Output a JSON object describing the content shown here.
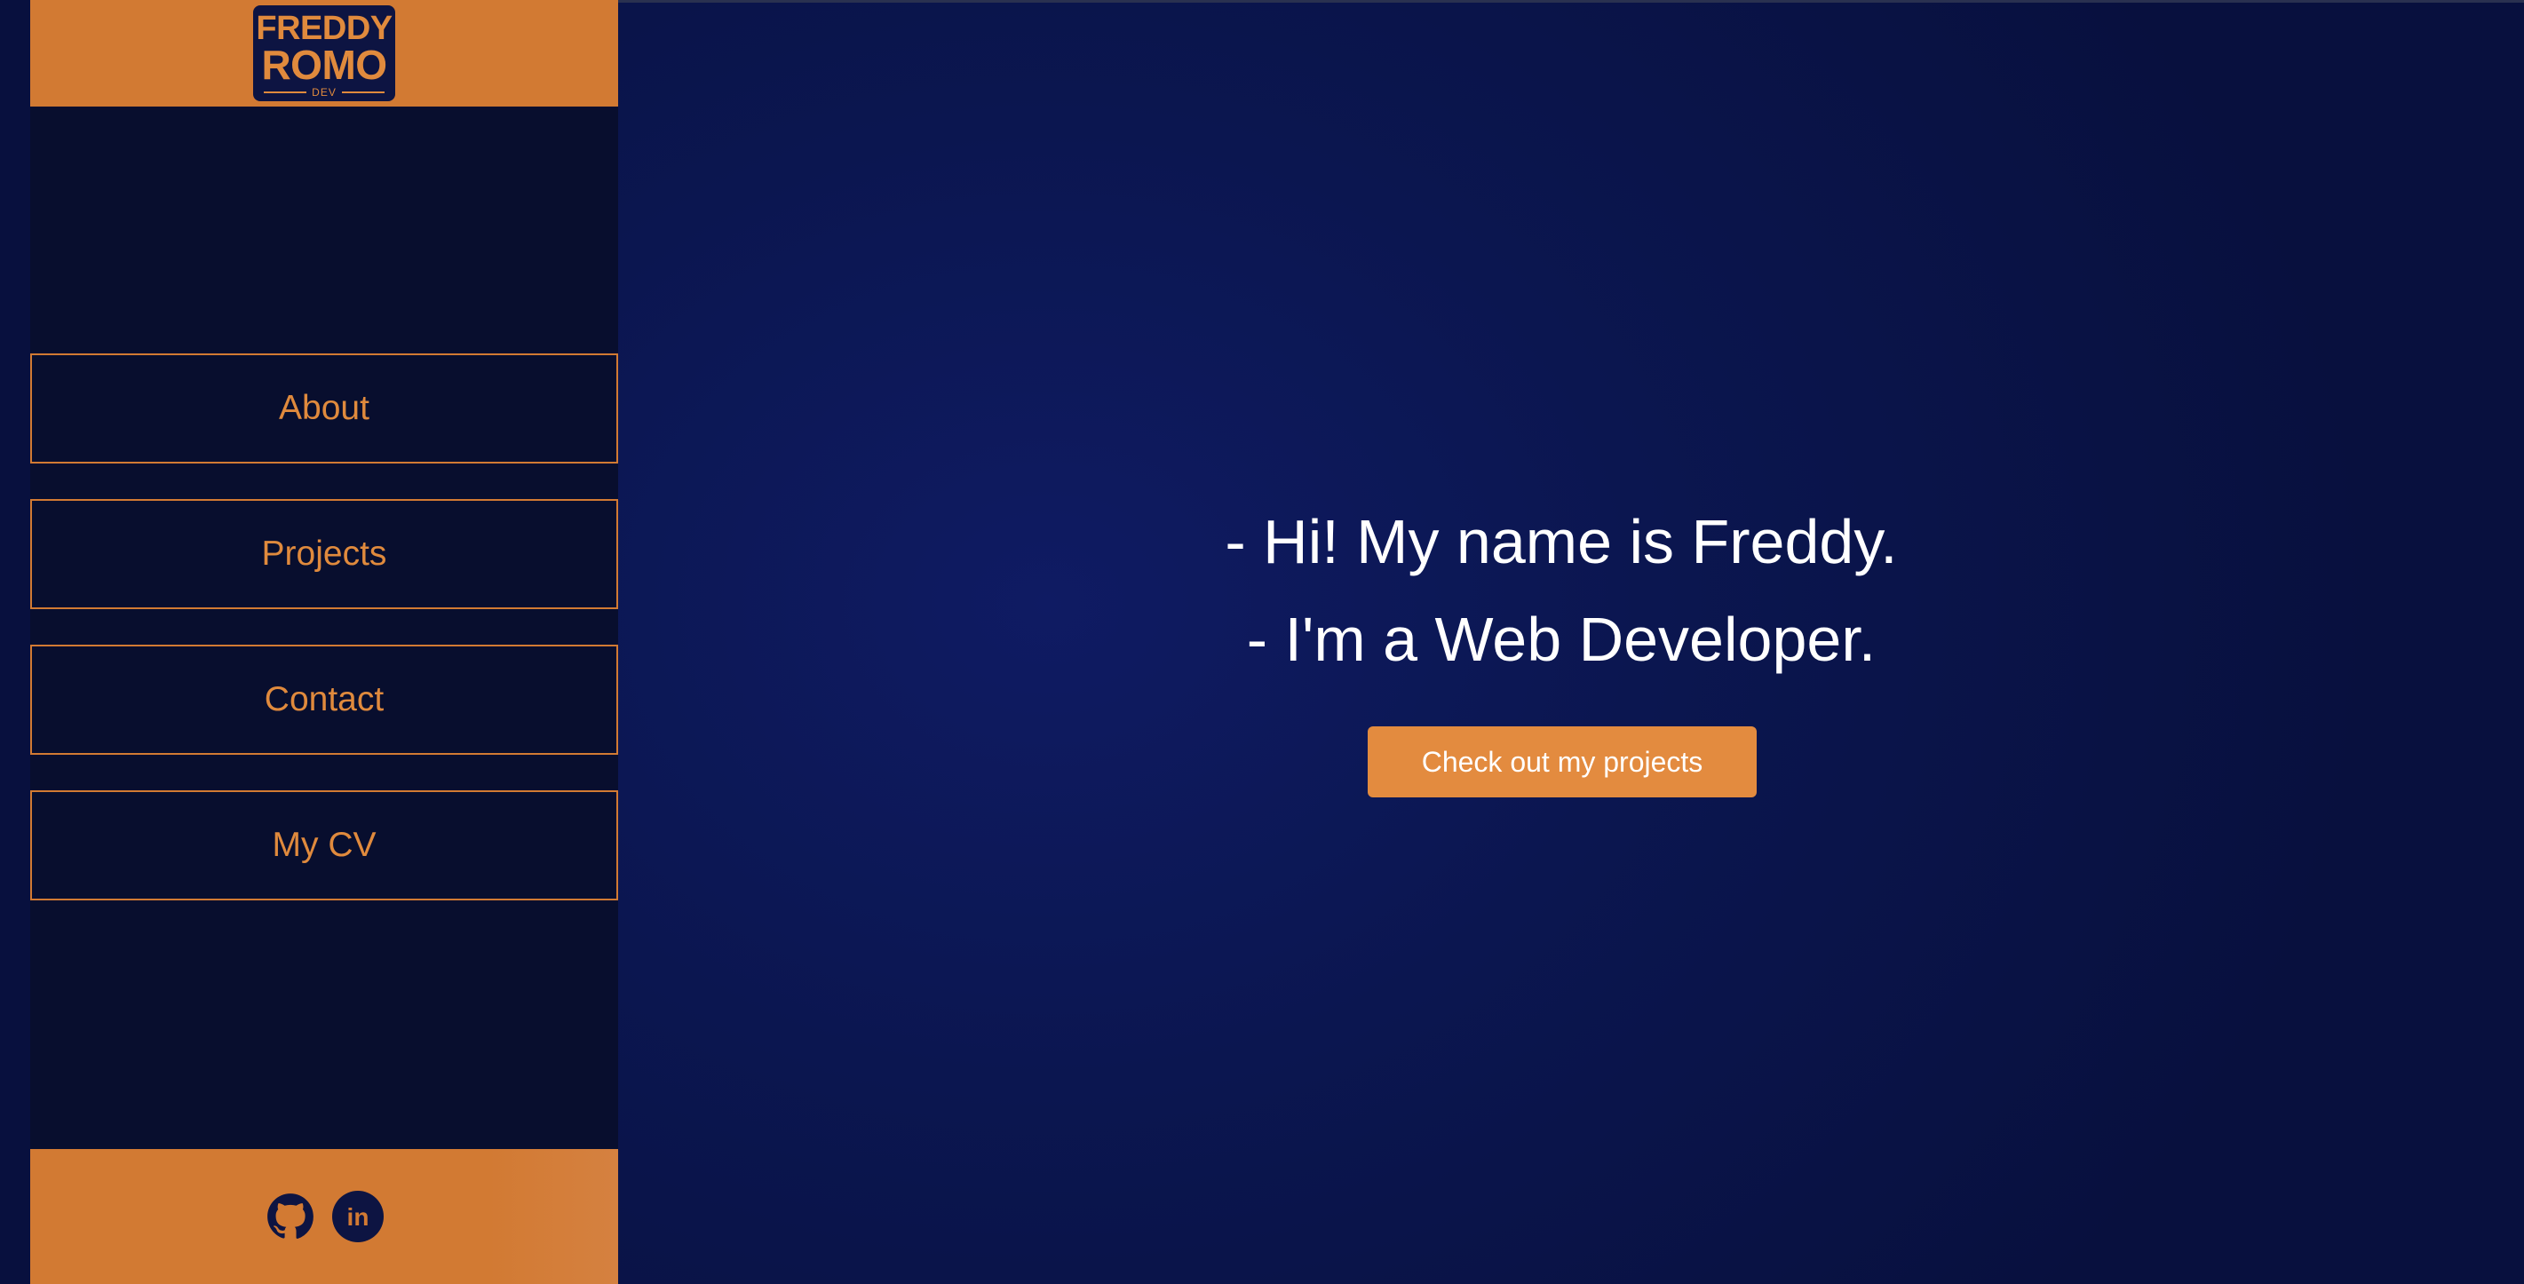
{
  "logo": {
    "line1": "FREDDY",
    "line2": "ROMO",
    "tag": "DEV"
  },
  "nav": {
    "items": [
      {
        "label": "About"
      },
      {
        "label": "Projects"
      },
      {
        "label": "Contact"
      },
      {
        "label": "My CV"
      }
    ]
  },
  "social": {
    "icons": [
      "github-icon",
      "linkedin-icon"
    ],
    "linkedin_text": "in"
  },
  "hero": {
    "line1": "- Hi! My name is Freddy.",
    "line2": "- I'm a Web Developer.",
    "cta_label": "Check out my projects"
  },
  "colors": {
    "accent": "#d27a33",
    "accent_text": "#e08a3d",
    "sidebar_bg": "#080e2e",
    "main_bg": "#0b1650",
    "hero_text": "#ffffff"
  }
}
